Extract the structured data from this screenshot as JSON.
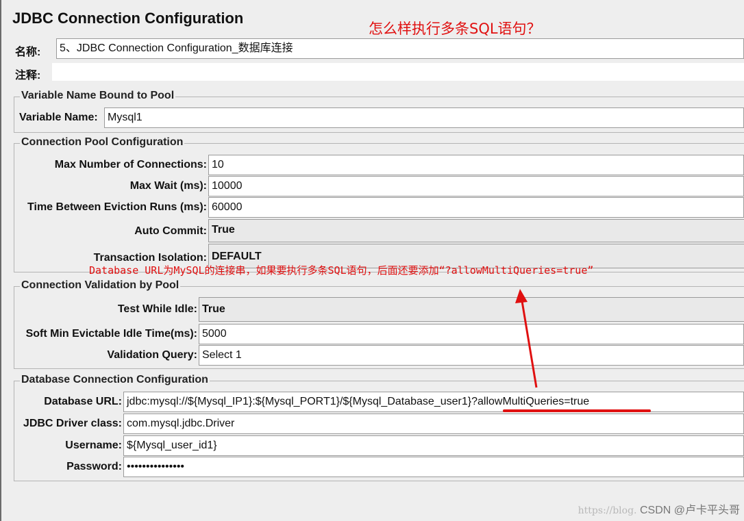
{
  "window": {
    "title": "JDBC Connection Configuration"
  },
  "annotations": {
    "question": "怎么样执行多条SQL语句？",
    "db_url_note": "Database URL为MySQL的连接串，如果要执行多条SQL语句，后面还要添加“?allowMultiQueries=true”"
  },
  "name_field": {
    "label": "名称:",
    "value": "5、JDBC Connection Configuration_数据库连接"
  },
  "comment_field": {
    "label": "注释:",
    "value": ""
  },
  "variable_group": {
    "title": "Variable Name Bound to Pool",
    "variable_name": {
      "label": "Variable Name:",
      "value": "Mysql1"
    }
  },
  "pool_group": {
    "title": "Connection Pool Configuration",
    "max_connections": {
      "label": "Max Number of Connections:",
      "value": "10"
    },
    "max_wait": {
      "label": "Max Wait (ms):",
      "value": "10000"
    },
    "eviction_runs": {
      "label": "Time Between Eviction Runs (ms):",
      "value": "60000"
    },
    "auto_commit": {
      "label": "Auto Commit:",
      "value": "True"
    },
    "transaction_isolation": {
      "label": "Transaction Isolation:",
      "value": "DEFAULT"
    }
  },
  "validation_group": {
    "title": "Connection Validation by Pool",
    "test_while_idle": {
      "label": "Test While Idle:",
      "value": "True"
    },
    "soft_min_evictable": {
      "label": "Soft Min Evictable Idle Time(ms):",
      "value": "5000"
    },
    "validation_query": {
      "label": "Validation Query:",
      "value": "Select 1"
    }
  },
  "database_group": {
    "title": "Database Connection Configuration",
    "database_url": {
      "label": "Database URL:",
      "value_base": "jdbc:mysql://${Mysql_IP1}:${Mysql_PORT1}/${Mysql_Database_user1}",
      "value_suffix": "?allowMultiQueries=true"
    },
    "driver_class": {
      "label": "JDBC Driver class:",
      "value": "com.mysql.jdbc.Driver"
    },
    "username": {
      "label": "Username:",
      "value": "${Mysql_user_id1}"
    },
    "password": {
      "label": "Password:",
      "value": "•••••••••••••••"
    }
  },
  "watermark": {
    "url": "https://blog.",
    "text": "CSDN @卢卡平头哥"
  },
  "colors": {
    "annotation_red": "#e01010",
    "background": "#eeeeee"
  }
}
